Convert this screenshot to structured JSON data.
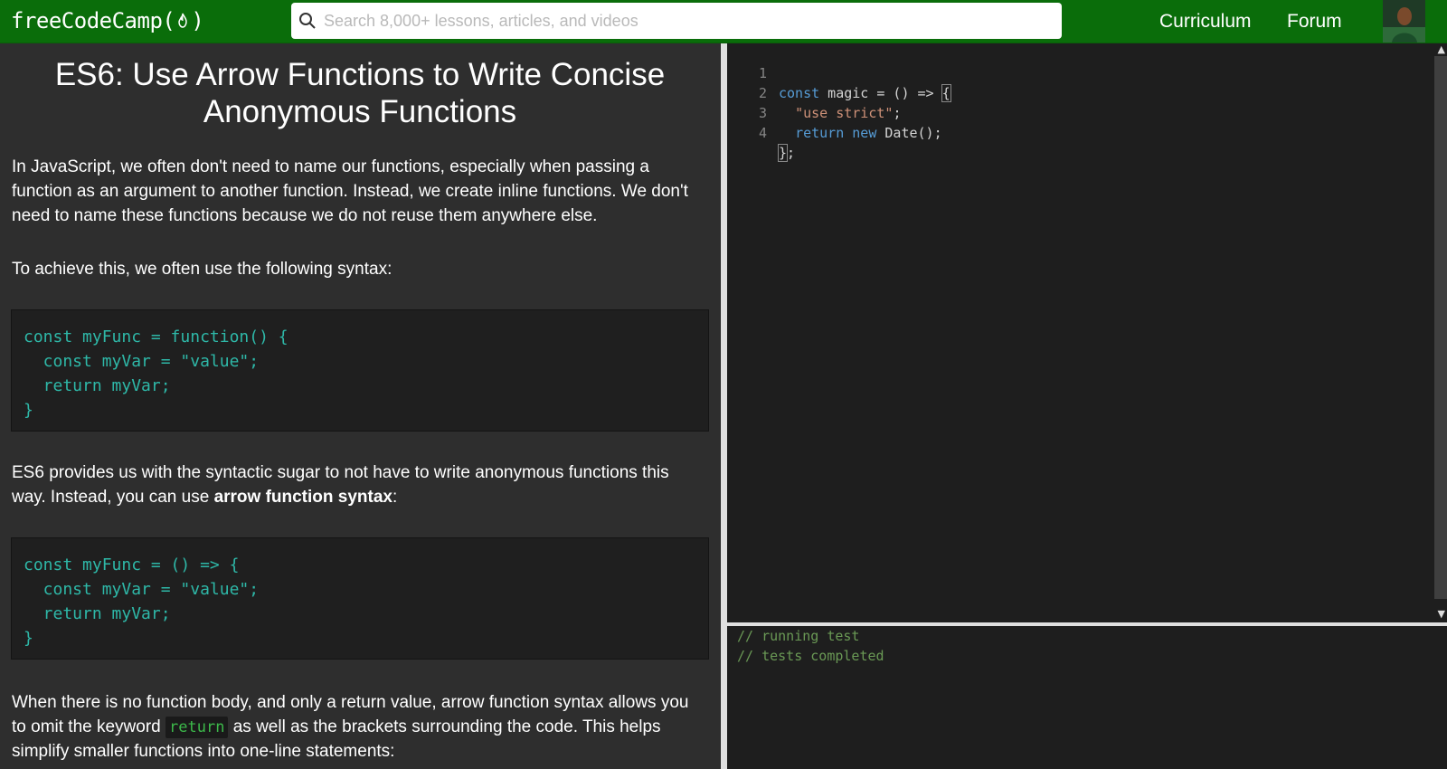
{
  "nav": {
    "logo_prefix": "freeCodeCamp(",
    "logo_suffix": ")",
    "search_placeholder": "Search 8,000+ lessons, articles, and videos",
    "links": [
      "Curriculum",
      "Forum"
    ]
  },
  "lesson": {
    "title_line1": "ES6: Use Arrow Functions to Write Concise",
    "title_line2": "Anonymous Functions",
    "p1": "In JavaScript, we often don't need to name our functions, especially when passing a function as an argument to another function. Instead, we create inline functions. We don't need to name these functions because we do not reuse them anywhere else.",
    "p2": "To achieve this, we often use the following syntax:",
    "code1": "const myFunc = function() {\n  const myVar = \"value\";\n  return myVar;\n}",
    "p3_prefix": "ES6 provides us with the syntactic sugar to not have to write anonymous functions this way. Instead, you can use ",
    "p3_bold": "arrow function syntax",
    "p3_suffix": ":",
    "code2": "const myFunc = () => {\n  const myVar = \"value\";\n  return myVar;\n}",
    "p4_prefix": "When there is no function body, and only a return value, arrow function syntax allows you to omit the keyword ",
    "p4_code": "return",
    "p4_suffix": " as well as the brackets surrounding the code. This helps simplify smaller functions into one-line statements:"
  },
  "editor": {
    "line_numbers": [
      "1",
      "2",
      "3",
      "4"
    ],
    "l1_kw": "const",
    "l1_rest": " magic = () => ",
    "l1_brace": "{",
    "l2_str": "\"use strict\"",
    "l2_semi": ";",
    "l3_kw1": "return",
    "l3_kw2": "new",
    "l3_rest": " Date();",
    "l4_brace": "}",
    "l4_semi": ";"
  },
  "console": {
    "lines": [
      "// running test",
      "// tests completed"
    ]
  },
  "colors": {
    "nav_bg": "#0a6d0a",
    "code_text": "#2eb8a8",
    "console_comment": "#6a9955"
  }
}
